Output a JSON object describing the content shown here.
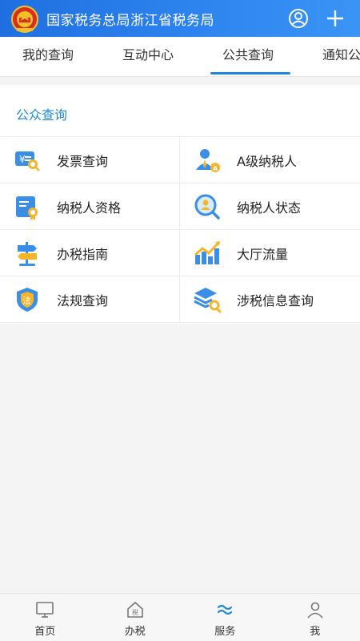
{
  "header": {
    "title": "国家税务总局浙江省税务局",
    "user_icon": "user-circle-icon",
    "add_icon": "plus-icon"
  },
  "tabs": [
    {
      "label": "我的查询",
      "active": false
    },
    {
      "label": "互动中心",
      "active": false
    },
    {
      "label": "公共查询",
      "active": true
    },
    {
      "label": "通知公告",
      "active": false
    }
  ],
  "section": {
    "title": "公众查询",
    "items": [
      {
        "label": "发票查询",
        "icon": "invoice-search-icon"
      },
      {
        "label": "A级纳税人",
        "icon": "a-level-taxpayer-icon"
      },
      {
        "label": "纳税人资格",
        "icon": "taxpayer-qualification-icon"
      },
      {
        "label": "纳税人状态",
        "icon": "taxpayer-status-icon"
      },
      {
        "label": "办税指南",
        "icon": "signpost-guide-icon"
      },
      {
        "label": "大厅流量",
        "icon": "hall-traffic-chart-icon"
      },
      {
        "label": "法规查询",
        "icon": "law-shield-icon"
      },
      {
        "label": "涉税信息查询",
        "icon": "stack-search-icon"
      }
    ]
  },
  "bottom_nav": [
    {
      "label": "首页",
      "icon": "monitor-home-icon",
      "active": false
    },
    {
      "label": "办税",
      "icon": "tax-house-icon",
      "active": false
    },
    {
      "label": "服务",
      "icon": "service-wave-icon",
      "active": true
    },
    {
      "label": "我",
      "icon": "person-icon",
      "active": false
    }
  ],
  "colors": {
    "header_bg": "#2f86f0",
    "accent": "#1e88d8",
    "text": "#222222"
  }
}
